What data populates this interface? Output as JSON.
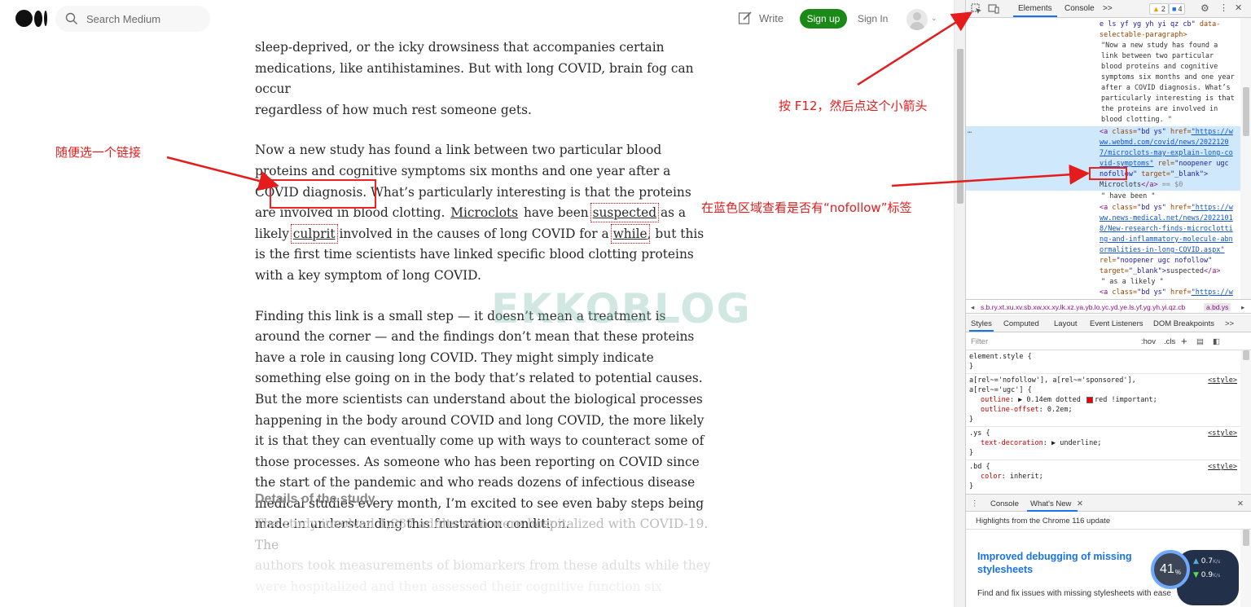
{
  "medium": {
    "search_placeholder": "Search Medium",
    "write_label": "Write",
    "signup_label": "Sign up",
    "signin_label": "Sign In"
  },
  "article": {
    "p1_line1": "sleep-deprived, or the icky drowsiness that accompanies certain",
    "p1_line2": "medications, like antihistamines. But with long COVID, brain fog can occur",
    "p1_line3": "regardless of how much rest someone gets.",
    "p2_a": "Now a new study has found a link between two particular blood proteins and cognitive symptoms six months and one year after a COVID diagnosis. What’s particularly interesting is that the proteins are involved in blood clotting. ",
    "p2_link1": "Microclots",
    "p2_b": " have been ",
    "p2_link2": "suspected",
    "p2_c": " as a likely ",
    "p2_link3": "culprit",
    "p2_d": " involved in the causes of long COVID for a ",
    "p2_link4": "while",
    "p2_e": ", but this is the first time scientists have linked specific blood clotting proteins with a key symptom of long COVID.",
    "p3": "Finding this link is a small step — it doesn’t mean a treatment is around the corner — and the findings don’t mean that these proteins have a role in causing long COVID. They might simply indicate something else going on in the body that’s related to potential causes. But the more scientists can understand about the biological processes happening in the body around COVID and long COVID, the more likely it is that they can eventually come up with ways to counteract some of those processes. As someone who has been reporting on COVID since the start of the pandemic and who reads dozens of infectious disease medical studies every month, I’m excited to see even baby steps being made in understanding this frustration condition.",
    "subhead": "Details of the study",
    "fade_line1": "The study involved 1,837 adults who were hospitalized with COVID-19. The",
    "fade_line2": "authors took measurements of biomarkers from these adults while they",
    "fade_line3": "were hospitalized and then assessed their cognitive function six"
  },
  "watermark": "EKKOBLOG",
  "annotations": {
    "pick_link": "随便选一个链接",
    "press_f12": "按 F12，然后点这个小箭头",
    "check_nofollow": "在蓝色区域查看是否有“nofollow”标签"
  },
  "devtools": {
    "tab_elements": "Elements",
    "tab_console": "Console",
    "more_tabs": ">>",
    "warn_count": "2",
    "issue_count": "4",
    "dom": {
      "l1a": "e ls yf yg yh yi qz cb\"",
      "l1b": " data-",
      "l2": "selectable-paragraph>",
      "t1": "\"Now a new study has found a",
      "t2": "link between two particular",
      "t3": "blood proteins and cognitive",
      "t4": "symptoms six months and one year",
      "t5": "after a COVID diagnosis. What’s",
      "t6": "particularly interesting is that",
      "t7": "the proteins are involved in",
      "t8": "blood clotting. \"",
      "a1_tag": "<a",
      "a1_class_attr": "class=",
      "a1_class_val": "\"bd ys\"",
      "a1_href_attr": "href=",
      "a1_href_1": "\"https://w",
      "a1_href_2": "ww.webmd.com/covid/news/2022120",
      "a1_href_3": "7/microclots-may-explain-long-co",
      "a1_href_4": "vid-symptoms\"",
      "a1_rel_attr": "rel=",
      "a1_rel_val": "\"noopener ugc",
      "a1_rel_val2": "nofollow\"",
      "a1_target_attr": "target=",
      "a1_target_val": "\"_blank\">",
      "a1_text": "Microclots",
      "a1_close": "</a>",
      "a1_eq": "== $0",
      "t9": "\" have been \"",
      "a2_href_1": "\"https://w",
      "a2_href_2": "ww.news-medical.net/news/2022101",
      "a2_href_3": "8/New-research-finds-microclotti",
      "a2_href_4": "ng-and-inflammatory-molecule-abn",
      "a2_href_5": "ormalities-in-long-COVID.aspx\"",
      "a2_rel": "\"noopener ugc nofollow\"",
      "a2_target": "\"_blank\">",
      "a2_text": "suspected",
      "t10": "\" as a likely \"",
      "a3_href": "\"https://w",
      "dots": "…"
    },
    "breadcrumbs": "s.b.ry.xt.xu.xv.sb.xw.xx.xy.lk.xz.ya.yb.lo.yc.yd.ye.ls.yf.yg.yh.yi.qz.cb",
    "breadcrumb_last": "a.bd.ys",
    "subtabs": [
      "Styles",
      "Computed",
      "Layout",
      "Event Listeners",
      "DOM Breakpoints",
      ">>"
    ],
    "filter_placeholder": "Filter",
    "hov": ":hov",
    "cls": ".cls",
    "styles": {
      "r1": "element.style {",
      "r1_close": "}",
      "r2_sel1": "a[rel~='nofollow'], a[rel~='sponsored'],",
      "r2_sel2": "a[rel~='ugc'] {",
      "r2_src": "<style>",
      "r2_p1": "outline",
      "r2_v1a": "▶ 0.14em dotted",
      "r2_v1b": "red !important;",
      "r2_p2": "outline-offset",
      "r2_v2": "0.2em;",
      "r2_close": "}",
      "r3_sel": ".ys {",
      "r3_src": "<style>",
      "r3_p": "text-decoration",
      "r3_v": "▶ underline;",
      "r3_close": "}",
      "r4_sel": ".bd {",
      "r4_src": "<style>",
      "r4_p": "color",
      "r4_v": "inherit;",
      "r4_close": "}"
    },
    "drawer_console": "Console",
    "drawer_whatsnew": "What's New",
    "highlights": "Highlights from the Chrome 116 update",
    "wn_title": "Improved debugging of missing stylesheets",
    "wn_desc": "Find and fix issues with missing stylesheets with ease"
  },
  "widget": {
    "percent": "41",
    "percent_sign": "%",
    "up": "0.7",
    "up_unit": "K/s",
    "down": "0.9",
    "down_unit": "K/s"
  }
}
